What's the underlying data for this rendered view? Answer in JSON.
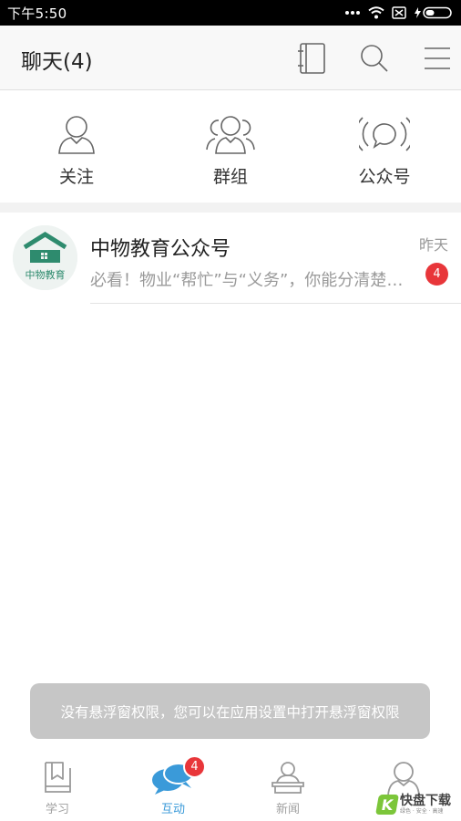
{
  "status_bar": {
    "time": "下午5:50"
  },
  "header": {
    "title": "聊天(4)"
  },
  "quick_tabs": [
    {
      "label": "关注",
      "icon": "person-icon"
    },
    {
      "label": "群组",
      "icon": "group-icon"
    },
    {
      "label": "公众号",
      "icon": "broadcast-icon"
    }
  ],
  "conversations": [
    {
      "title": "中物教育公众号",
      "preview": "必看！物业“帮忙”与“义务”，你能分清楚吗？",
      "time": "昨天",
      "unread": "4",
      "avatar_text": "中物教育"
    }
  ],
  "toast": {
    "message": "没有悬浮窗权限，您可以在应用设置中打开悬浮窗权限"
  },
  "bottom_nav": [
    {
      "label": "学习",
      "icon": "book-icon",
      "active": false
    },
    {
      "label": "互动",
      "icon": "chat-bubbles-icon",
      "active": true,
      "badge": "4"
    },
    {
      "label": "新闻",
      "icon": "news-icon",
      "active": false
    },
    {
      "label": "",
      "icon": "profile-icon",
      "active": false
    }
  ],
  "watermark": {
    "title": "快盘下载",
    "subtitle": "绿色 · 安全 · 高速"
  },
  "colors": {
    "accent": "#3a9ad9",
    "badge": "#e8363a",
    "toast_bg": "#c6c6c6",
    "logo_green": "#2e8b6e"
  }
}
